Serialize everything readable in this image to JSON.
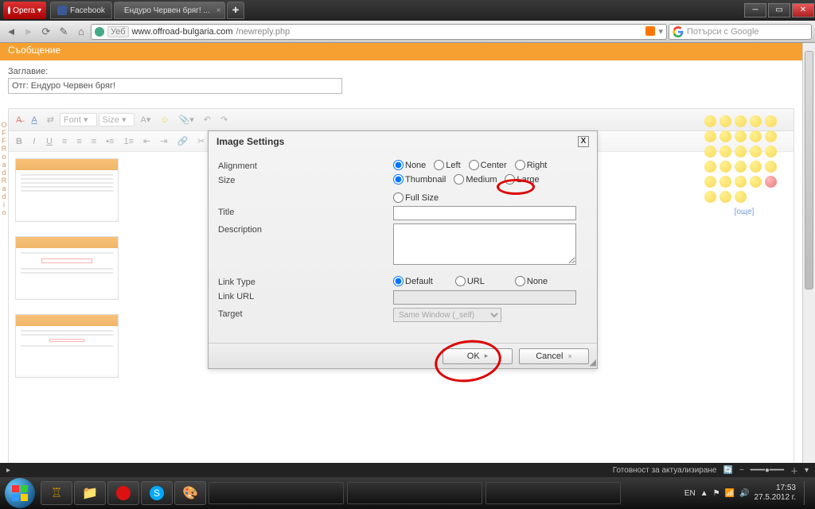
{
  "browser": {
    "name": "Opera",
    "tabs": [
      {
        "label": "Facebook"
      },
      {
        "label": "Ендуро Червен бряг! ..."
      }
    ],
    "url_prefix": "Уеб",
    "url_domain": "www.offroad-bulgaria.com",
    "url_path": "/newreply.php",
    "search_placeholder": "Потърси с Google"
  },
  "page": {
    "section": "Съобщение",
    "title_label": "Заглавие:",
    "title_value": "Отг: Ендуро Червен бряг!",
    "editor": {
      "font_label": "Font",
      "size_label": "Size"
    },
    "smilies_more": "[още]"
  },
  "dialog": {
    "title": "Image Settings",
    "labels": {
      "alignment": "Alignment",
      "size": "Size",
      "title_field": "Title",
      "description": "Description",
      "link_type": "Link Type",
      "link_url": "Link URL",
      "target": "Target"
    },
    "alignment": {
      "none": "None",
      "left": "Left",
      "center": "Center",
      "right": "Right",
      "selected": "none"
    },
    "size": {
      "thumbnail": "Thumbnail",
      "medium": "Medium",
      "large": "Large",
      "full": "Full Size",
      "selected": "thumbnail"
    },
    "link_type": {
      "default": "Default",
      "url": "URL",
      "none": "None",
      "selected": "default"
    },
    "target_value": "Same Window (_self)",
    "buttons": {
      "ok": "OK",
      "cancel": "Cancel"
    }
  },
  "statusbar": {
    "text": "Готовност за актуализиране"
  },
  "taskbar": {
    "lang": "EN",
    "time": "17:53",
    "date": "27.5.2012 г."
  }
}
